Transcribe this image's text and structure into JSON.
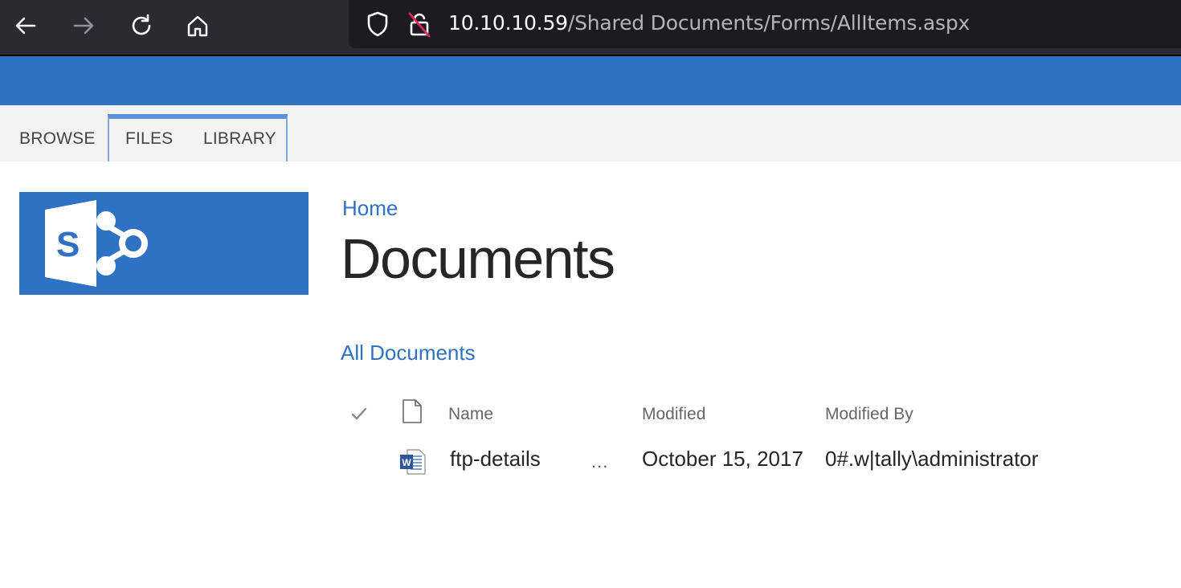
{
  "browser": {
    "url_host": "10.10.10.59",
    "url_path": "/Shared Documents/Forms/AllItems.aspx"
  },
  "icons": {
    "back": "back-arrow-icon",
    "forward": "forward-arrow-icon",
    "reload": "reload-icon",
    "home": "home-icon",
    "shield": "tracking-protection-shield-icon",
    "insecure": "insecure-lock-icon",
    "logo": "sharepoint-logo",
    "check": "checkmark-icon",
    "doc": "document-icon",
    "word": "word-document-icon"
  },
  "colors": {
    "suite_bar": "#2f72c4",
    "link": "#2f72c4",
    "browser_bg": "#2b2a33",
    "urlbar_bg": "#1c1b22"
  },
  "ribbon": {
    "tabs": [
      "BROWSE",
      "FILES",
      "LIBRARY"
    ]
  },
  "breadcrumb": {
    "home": "Home"
  },
  "page": {
    "title": "Documents",
    "view_link": "All Documents"
  },
  "list": {
    "columns": {
      "name": "Name",
      "modified": "Modified",
      "modified_by": "Modified By"
    },
    "rows": [
      {
        "name": "ftp-details",
        "more": "...",
        "modified": "October 15, 2017",
        "modified_by": "0#.w|tally\\administrator"
      }
    ]
  }
}
